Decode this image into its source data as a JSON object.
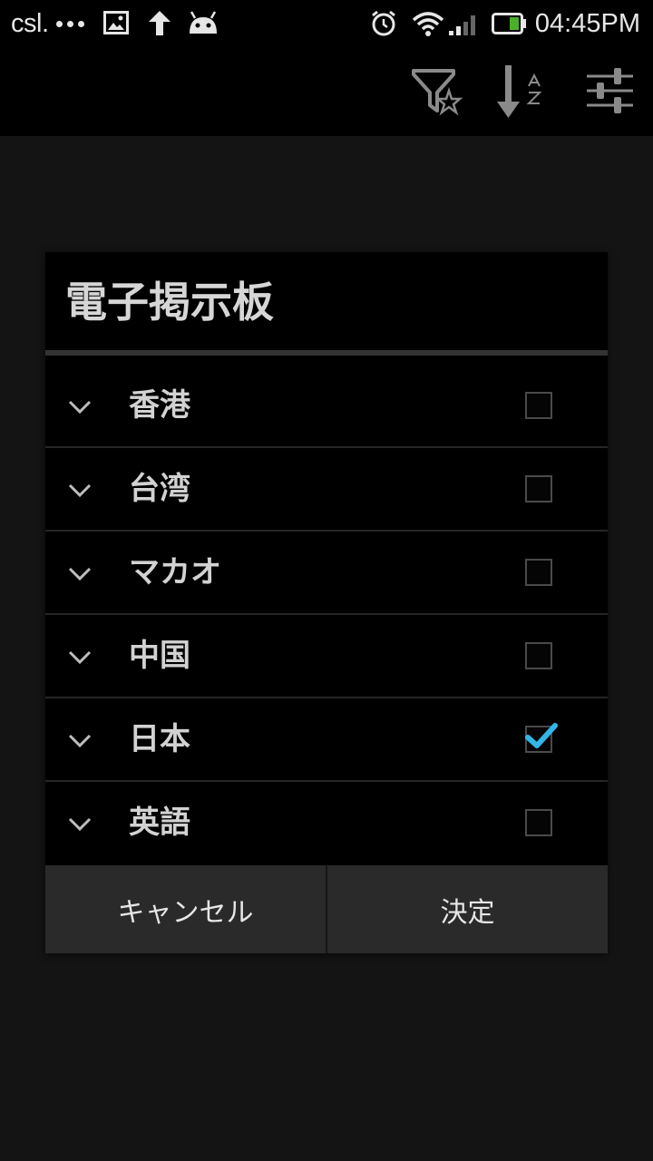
{
  "status_bar": {
    "carrier": "csl.",
    "time": "04:45PM",
    "icons": [
      "more-dots-icon",
      "image-icon",
      "upload-arrow-icon",
      "android-icon",
      "alarm-icon",
      "wifi-icon",
      "signal-icon",
      "battery-icon"
    ]
  },
  "action_bar": {
    "icons": [
      "filter-favorite-icon",
      "sort-az-icon",
      "settings-sliders-icon"
    ]
  },
  "dialog": {
    "title": "電子掲示板",
    "items": [
      {
        "label": "香港",
        "checked": false
      },
      {
        "label": "台湾",
        "checked": false
      },
      {
        "label": "マカオ",
        "checked": false
      },
      {
        "label": "中国",
        "checked": false
      },
      {
        "label": "日本",
        "checked": true
      },
      {
        "label": "英語",
        "checked": false
      }
    ],
    "cancel_label": "キャンセル",
    "ok_label": "決定"
  },
  "colors": {
    "background": "#141414",
    "bar": "#000000",
    "button_bar": "#2a2a2a",
    "check_accent": "#33b5e5"
  }
}
